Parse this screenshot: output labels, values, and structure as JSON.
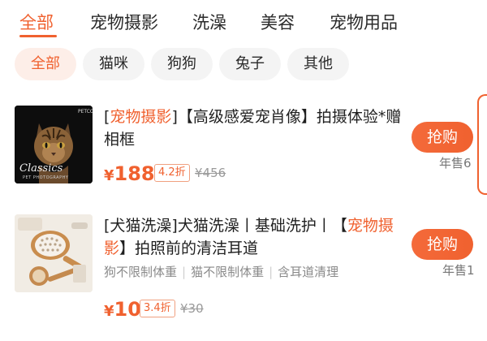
{
  "tabs": [
    {
      "label": "全部",
      "active": true
    },
    {
      "label": "宠物摄影",
      "active": false
    },
    {
      "label": "洗澡",
      "active": false
    },
    {
      "label": "美容",
      "active": false
    },
    {
      "label": "宠物用品",
      "active": false
    }
  ],
  "chips": [
    {
      "label": "全部",
      "active": true
    },
    {
      "label": "猫咪",
      "active": false
    },
    {
      "label": "狗狗",
      "active": false
    },
    {
      "label": "兔子",
      "active": false
    },
    {
      "label": "其他",
      "active": false
    }
  ],
  "products": [
    {
      "title_parts": [
        "[",
        "宠物摄影",
        "]【高级感爱宠肖像】拍摄体验*赠相框"
      ],
      "price_currency": "¥",
      "price": "188",
      "discount": "4.2折",
      "original_price": "¥456",
      "buy_label": "抢购",
      "sold": "年售6",
      "image_text": {
        "brand": "PETCO",
        "script": "Classics",
        "caption": "PET PHOTOGRAPHY"
      }
    },
    {
      "title_parts": [
        "[犬猫洗澡]犬猫洗澡丨基础洗护丨【",
        "宠物摄影",
        "】拍照前的清洁耳道"
      ],
      "tags": [
        "狗不限制体重",
        "猫不限制体重",
        "含耳道清理"
      ],
      "price_currency": "¥",
      "price": "10",
      "discount": "3.4折",
      "original_price": "¥30",
      "buy_label": "抢购",
      "sold": "年售1"
    }
  ],
  "colors": {
    "accent": "#f0612f",
    "chip_active_bg": "#fdeee8",
    "chip_bg": "#f4f4f4"
  }
}
